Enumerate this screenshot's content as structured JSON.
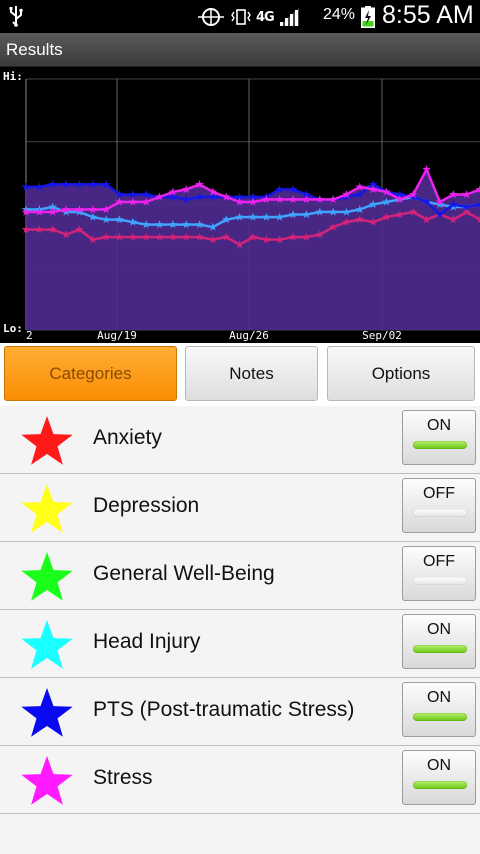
{
  "status_bar": {
    "network": "4G",
    "battery_percent": "24%",
    "time": "8:55 AM",
    "icons": [
      "usb-icon",
      "sync-icon",
      "vibrate-icon",
      "4g-icon",
      "signal-icon",
      "battery-charging-icon"
    ]
  },
  "title_bar": {
    "title": "Results"
  },
  "chart_data": {
    "type": "line",
    "y_top_label": "Hi:",
    "y_bottom_label": "Lo:",
    "x_tick_labels": [
      "2",
      "Aug/19",
      "Aug/26",
      "Sep/02"
    ],
    "ylim": [
      0,
      100
    ],
    "grid": true,
    "fill_color": "#4d2a8e",
    "series": [
      {
        "name": "Anxiety",
        "color": "#d4237a",
        "values": [
          40,
          40,
          40,
          38,
          40,
          36,
          37,
          37,
          37,
          37,
          37,
          37,
          37,
          37,
          36,
          37,
          34,
          37,
          36,
          36,
          37,
          37,
          38,
          41,
          43,
          44,
          43,
          45,
          46,
          47,
          44,
          46,
          44,
          47,
          44
        ]
      },
      {
        "name": "Head Injury",
        "color": "#3fa3ff",
        "values": [
          48,
          48,
          49,
          47,
          47,
          45,
          44,
          44,
          43,
          42,
          42,
          42,
          42,
          42,
          41,
          44,
          45,
          45,
          45,
          45,
          46,
          46,
          47,
          47,
          47,
          48,
          50,
          51,
          52,
          53,
          51,
          50,
          49,
          49,
          50
        ]
      },
      {
        "name": "PTS (Post-traumatic Stress)",
        "color": "#1616e8",
        "values": [
          57,
          57,
          58,
          58,
          58,
          58,
          58,
          54,
          54,
          54,
          53,
          53,
          52,
          53,
          53,
          53,
          53,
          53,
          53,
          56,
          56,
          54,
          52,
          52,
          53,
          54,
          58,
          55,
          54,
          53,
          51,
          46,
          50,
          49,
          50
        ]
      },
      {
        "name": "Stress",
        "color": "#ee22ee",
        "values": [
          47,
          47,
          47,
          48,
          48,
          48,
          48,
          51,
          51,
          51,
          53,
          55,
          56,
          58,
          55,
          53,
          51,
          51,
          52,
          52,
          52,
          52,
          52,
          52,
          54,
          57,
          56,
          55,
          52,
          54,
          64,
          51,
          54,
          54,
          56
        ]
      }
    ]
  },
  "tabs": [
    {
      "label": "Categories",
      "active": true
    },
    {
      "label": "Notes",
      "active": false
    },
    {
      "label": "Options",
      "active": false
    }
  ],
  "categories": [
    {
      "name": "Anxiety",
      "star_color": "#ff1a1a",
      "state": "ON",
      "on": true
    },
    {
      "name": "Depression",
      "star_color": "#ffff1a",
      "state": "OFF",
      "on": false
    },
    {
      "name": "General Well-Being",
      "star_color": "#1aff1a",
      "state": "OFF",
      "on": false
    },
    {
      "name": "Head Injury",
      "star_color": "#1affff",
      "state": "ON",
      "on": true
    },
    {
      "name": "PTS (Post-traumatic Stress)",
      "star_color": "#0a0af0",
      "state": "ON",
      "on": true
    },
    {
      "name": "Stress",
      "star_color": "#ff1aff",
      "state": "ON",
      "on": true
    }
  ]
}
